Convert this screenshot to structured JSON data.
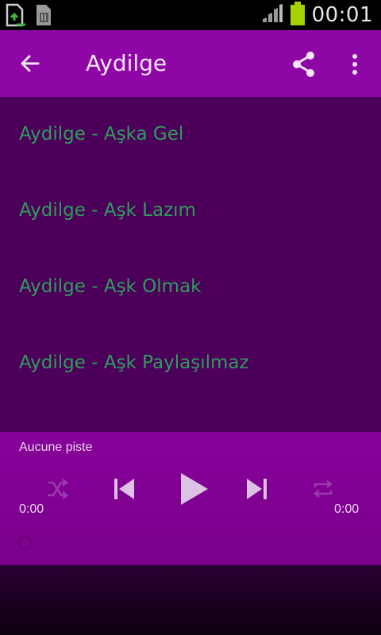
{
  "status_bar": {
    "time": "00:01",
    "icons": [
      "upload-file-icon",
      "sd-card-icon",
      "signal-icon",
      "battery-icon"
    ],
    "battery_color": "#a4d100"
  },
  "app_bar": {
    "title": "Aydilge",
    "background": "#8e06a6",
    "icons": [
      "back-arrow-icon",
      "share-icon",
      "more-vert-icon"
    ]
  },
  "tracks": [
    {
      "label": "Aydilge - Aşka Gel"
    },
    {
      "label": "Aydilge - Aşk Lazım"
    },
    {
      "label": "Aydilge - Aşk Olmak"
    },
    {
      "label": "Aydilge - Aşk Paylaşılmaz"
    }
  ],
  "track_text_color": "#2f9b5d",
  "player": {
    "now_playing": "Aucune piste",
    "elapsed": "0:00",
    "duration": "0:00",
    "progress": 0,
    "controls": [
      "shuffle-icon",
      "previous-icon",
      "play-icon",
      "next-icon",
      "repeat-icon"
    ]
  }
}
